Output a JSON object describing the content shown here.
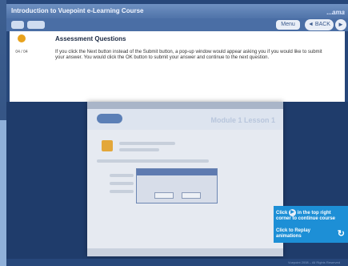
{
  "window": {
    "title": "Introduction to Vuepoint e-Learning Course",
    "logo_text": "...ama"
  },
  "toolbar": {
    "menu_label": "Menu",
    "back_label": "◄ BACK",
    "next_label": "►"
  },
  "content": {
    "badge_label": "04 / 04",
    "heading": "Assessment Questions",
    "paragraph": "If you click the Next button instead of the Submit button, a pop-up window would appear asking you if you would like to submit your answer.  You would click the OK button to submit your answer and continue to the next question."
  },
  "embedded": {
    "title": "Module 1 Lesson 1"
  },
  "tooltip": {
    "text_before_icon": "Click",
    "text_after_icon": "in the top right corner to continue course",
    "replay_text": "Click to Replay animations"
  },
  "footer": {
    "text": "Vuepoint 2008 – All Rights Reserved"
  },
  "colors": {
    "accent": "#1d8fd6",
    "background": "#2f4f7d"
  }
}
